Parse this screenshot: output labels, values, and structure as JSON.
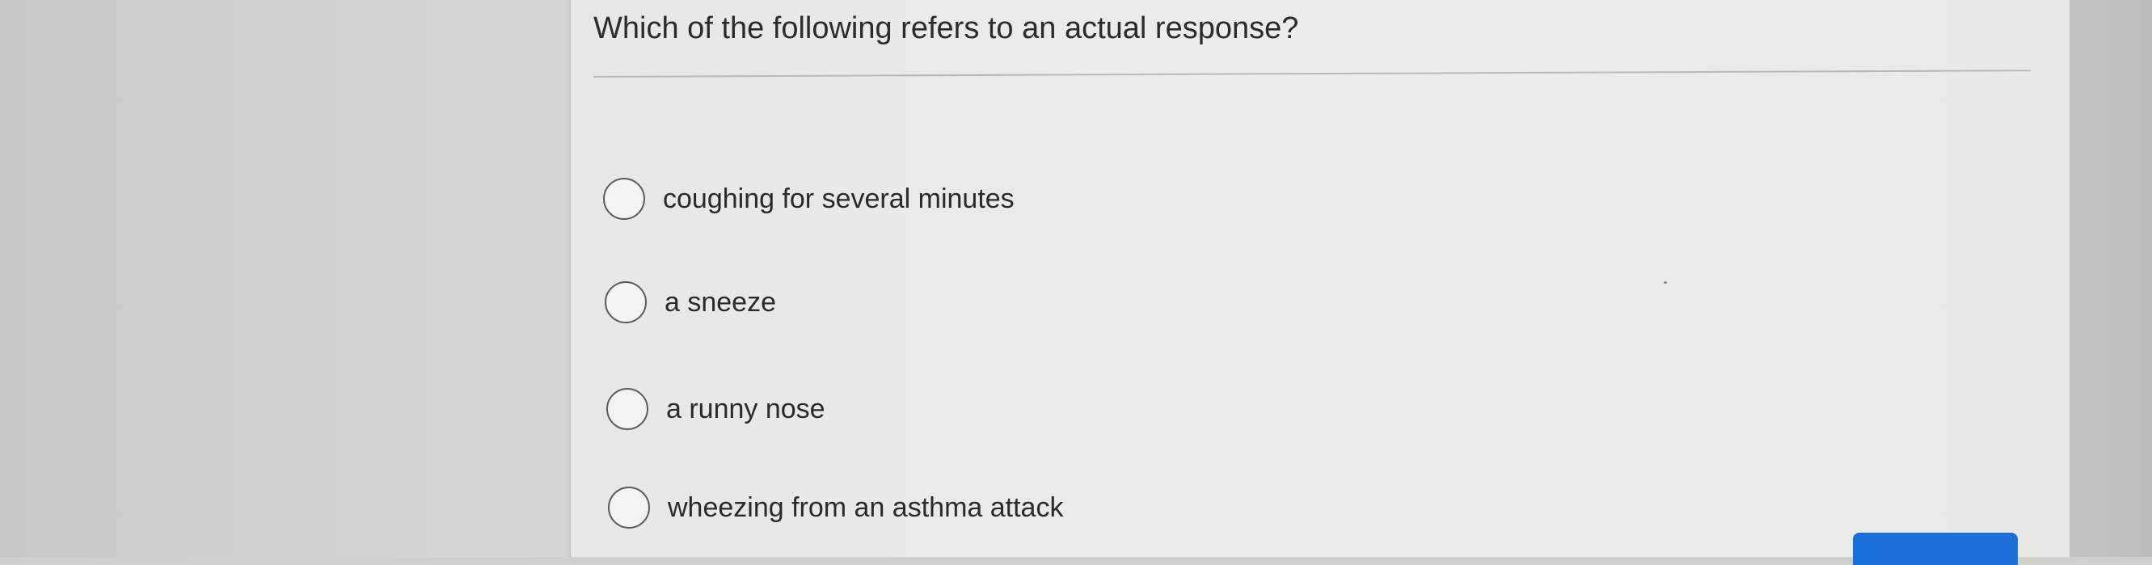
{
  "question": {
    "text": "Which of the following refers to an actual response?"
  },
  "choices": [
    {
      "label": "coughing for several minutes",
      "selected": false
    },
    {
      "label": "a sneeze",
      "selected": false
    },
    {
      "label": "a runny nose",
      "selected": false
    },
    {
      "label": "wheezing from an asthma attack",
      "selected": false
    }
  ],
  "submit_button": {
    "color": "#1a6fd8"
  }
}
